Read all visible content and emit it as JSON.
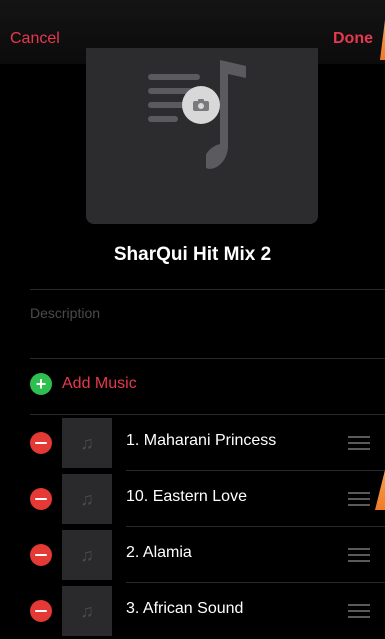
{
  "nav": {
    "cancel_label": "Cancel",
    "done_label": "Done"
  },
  "playlist": {
    "title": "SharQui Hit Mix 2",
    "description_placeholder": "Description",
    "add_music_label": "Add Music"
  },
  "songs": [
    {
      "title": "1. Maharani Princess"
    },
    {
      "title": "10. Eastern Love"
    },
    {
      "title": "2. Alamia"
    },
    {
      "title": "3. African Sound"
    }
  ],
  "colors": {
    "accent": "#e8384f",
    "add": "#2fbf4f",
    "remove": "#e53935"
  }
}
